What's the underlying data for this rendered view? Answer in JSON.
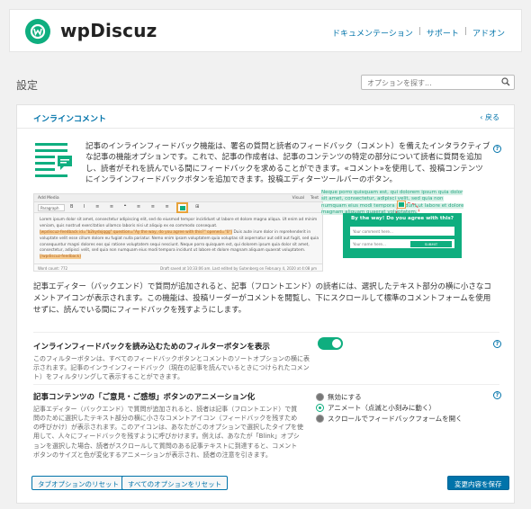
{
  "header": {
    "logo_text": "wpDiscuz",
    "nav": [
      "ドキュメンテーション",
      "サポート",
      "アドオン"
    ]
  },
  "page": {
    "title": "設定",
    "search_placeholder": "オプションを探す..."
  },
  "section": {
    "title": "インラインコメント",
    "back": "戻る",
    "intro": "記事のインラインフィードバック機能は、署名の質問と読者のフィードバック（コメント）を備えたインタラクティブな記事の機能オプションです。これで、記事の作成者は、記事のコンテンツの特定の部分について読者に質問を追加し、読者がそれを読んでいる間にフィードバックを求めることができます。«コメント»を使用して、投稿コンテンツにインラインフィードバックボタンを追加できます。投稿エディターツールバーのボタン。",
    "description": "記事エディター（バックエンド）で質問が追加されると、記事（フロントエンド）の読者には、選択したテキスト部分の横に小さなコメントアイコンが表示されます。この機能は、投稿リーダーがコメントを閲覧し、下にスクロールして標準のコメントフォームを使用せずに、読んでいる間にフィードバックを残すようにします。"
  },
  "screenshot_editor": {
    "add_media": "Add Media",
    "visual_tab": "Visual",
    "text_tab": "Text",
    "paragraph": "Paragraph",
    "body": "Lorem ipsum dolor sit amet, consectetur adipiscing elit, sed do eiusmod tempor incididunt ut labore et dolore magna aliqua. Ut enim ad minim veniam, quis nostrud exercitation ullamco laboris nisi ut aliquip ex ea commodo consequat.",
    "highlight": "[wpdiscuz-feedback id=\"b2kydxjqgg\" question=\"Ay the way, do you agree with this?\" opened=\"0\"]",
    "highlight_tail": "Duis aute irure dolor in reprehenderit in voluptate velit esse cillum dolore eu fugiat nulla pariatur.",
    "body2": "Nemo enim ipsam voluptatem quia voluptas sit aspernatur aut odit aut fugit, sed quia consequuntur magni dolores eos qui ratione voluptatem sequi nesciunt. Neque porro quisquam est, qui dolorem ipsum quia dolor sit amet, consectetur, adipisci velit, sed quia non numquam eius modi tempora incidunt ut labore et dolore magnam aliquam quaerat voluptatem.",
    "tail_mark": "[/wpdiscuz-feedback]",
    "word_count": "Word count: 772",
    "last_edited": "Draft saved at 10:33:06 am. Last edited by Gutenberg on February 4, 2020 at 4:08 pm"
  },
  "screenshot_frontend": {
    "text": "Neque porro quisquam est, qui dolorem ipsum quia dolor sit amet, consectetur, adipisci velit, sed quia non numquam eius modi tempora incidunt ut labore et dolore magnam aliquam quaerat voluptatem.",
    "question": "By the way! Do you agree with this?",
    "comment_placeholder": "Your comment here...",
    "name_placeholder": "Your name here...",
    "submit": "SUBMIT"
  },
  "option1": {
    "title": "インラインフィードバックを読み込むためのフィルターボタンを表示",
    "desc": "このフィルターボタンは、すべてのフィードバックボタンとコメントのソートオプションの横に表示されます。記事のインラインフィードバック（現在の記事を読んでいるときにつけられたコメント）をフィルタリングして表示することができます。",
    "enabled": true
  },
  "option2": {
    "title": "記事コンテンツの「ご意見・ご感想」ボタンのアニメーション化",
    "desc": "記事エディター（バックエンド）で質問が追加されると、読者は記事（フロントエンド）で質問のために選択したテキスト部分の横に小さなコメントアイコン（フィードバックを残すための呼びかけ）が表示されます。このアイコンは、あなたがこのオプションで選択したタイプを使用して、人々にフィードバックを残すように呼びかけます。例えば、あなたが「Blink」オプションを選択した場合、読者がスクロールして質問のある記事テキストに到達すると、コメントボタンのサイズと色が変化するアニメーションが表示され、読者の注意を引きます。",
    "choices": [
      "無効にする",
      "アニメート（点滅と小刻みに動く）",
      "スクロールでフィードバックフォームを開く"
    ],
    "selected_index": 1
  },
  "buttons": {
    "reset_tab": "タブオプションのリセット",
    "reset_all": "すべてのオプションをリセット",
    "save": "変更内容を保存"
  },
  "colors": {
    "brand_green": "#0fae7f",
    "link_blue": "#0073aa",
    "highlight_orange": "#e8a33b"
  }
}
